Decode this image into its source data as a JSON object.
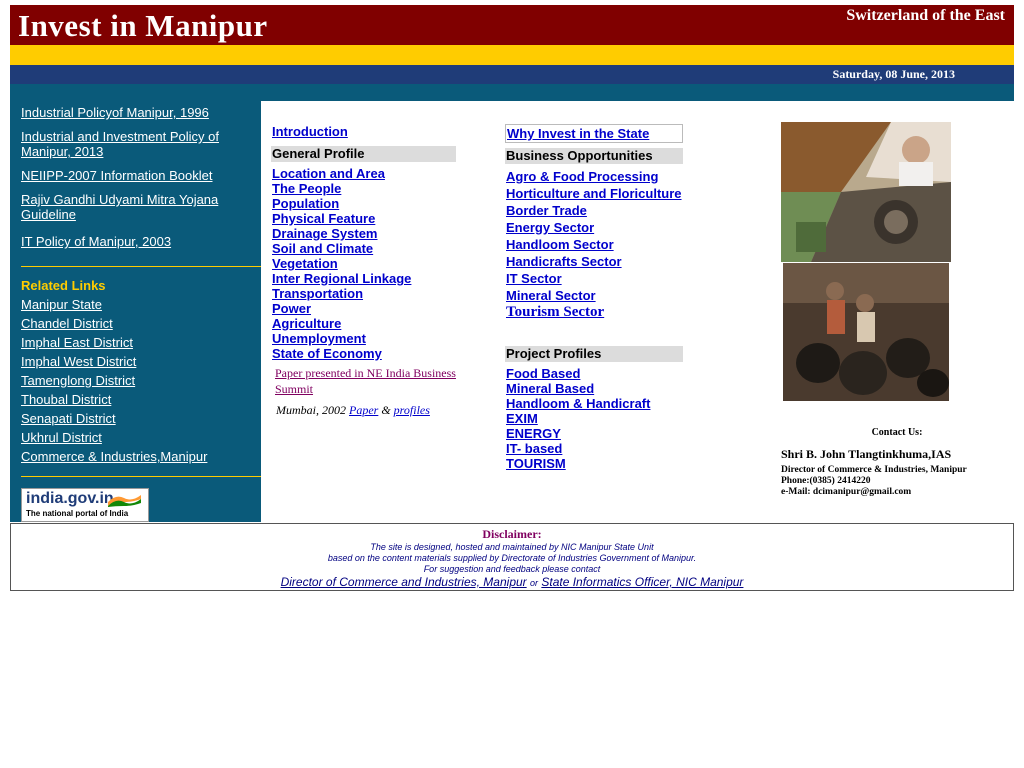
{
  "header": {
    "title": "Invest in Manipur",
    "tagline": "Switzerland of the East",
    "date": "Saturday, 08 June, 2013"
  },
  "sidebar": {
    "policy_links": [
      "Industrial Policyof Manipur, 1996",
      "Industrial and Investment Policy of Manipur, 2013",
      "NEIIPP-2007 Information Booklet",
      "Rajiv Gandhi Udyami Mitra Yojana Guideline",
      "IT Policy of Manipur, 2003"
    ],
    "related_heading": "Related Links",
    "related_links": [
      "Manipur State",
      "Chandel District",
      "Imphal East District",
      "Imphal West District",
      "Tamenglong District",
      "Thoubal District",
      "Senapati District",
      "Ukhrul District",
      "Commerce & Industries,Manipur"
    ],
    "india_badge": {
      "name": "india.gov.in",
      "subtitle": "The national portal of India"
    }
  },
  "column1": {
    "introduction": "Introduction",
    "general_profile_heading": "General Profile",
    "general_profile_links": [
      "Location and Area",
      "The People",
      "Population",
      "Physical Feature",
      "Drainage System",
      "Soil and Climate",
      "Vegetation",
      "Inter Regional Linkage",
      "Transportation",
      "Power",
      "Agriculture",
      "Unemployment",
      "State of Economy"
    ],
    "paper_note": "Paper presented in NE India Business Summit",
    "mumbai_prefix": "Mumbai, 2002",
    "paper_link": "Paper",
    "amp": "&",
    "profiles_link": "profiles"
  },
  "column2": {
    "why_invest": "Why Invest in the State",
    "business_heading": "Business Opportunities",
    "business_links": [
      "Agro & Food Processing",
      "Horticulture and Floriculture",
      "Border Trade",
      "Energy Sector",
      "Handloom Sector",
      "Handicrafts Sector",
      "IT Sector",
      "Mineral Sector"
    ],
    "tourism_link": "Tourism Sector",
    "project_heading": "Project Profiles",
    "project_links": [
      "Food Based",
      "Mineral Based",
      "Handloom & Handicraft",
      "EXIM",
      "ENERGY",
      "IT- based",
      "TOURISM"
    ]
  },
  "contact": {
    "heading": "Contact Us:",
    "name": "Shri B. John Tlangtinkhuma,IAS",
    "designation": "Director of Commerce & Industries, Manipur",
    "phone": "Phone:(0385) 2414220",
    "email": "e-Mail: dcimanipur@gmail.com"
  },
  "footer": {
    "disclaimer_title": "Disclaimer:",
    "lines": [
      "The site is designed, hosted and maintained by NIC Manipur State Unit",
      "based on the content materials supplied by Directorate of Industries Government of  Manipur.",
      "For suggestion and feedback please contact"
    ],
    "link_director": "Director of Commerce and Industries, Manipur",
    "or": "or",
    "link_sio": "State Informatics Officer, NIC Manipur"
  },
  "colors": {
    "banner": "#800000",
    "yellow_band": "#ffcc00",
    "date_band": "#1f3c78",
    "sidebar": "#0a5a7a",
    "link": "#0000cc",
    "heading_gray": "#dcdcdc"
  }
}
